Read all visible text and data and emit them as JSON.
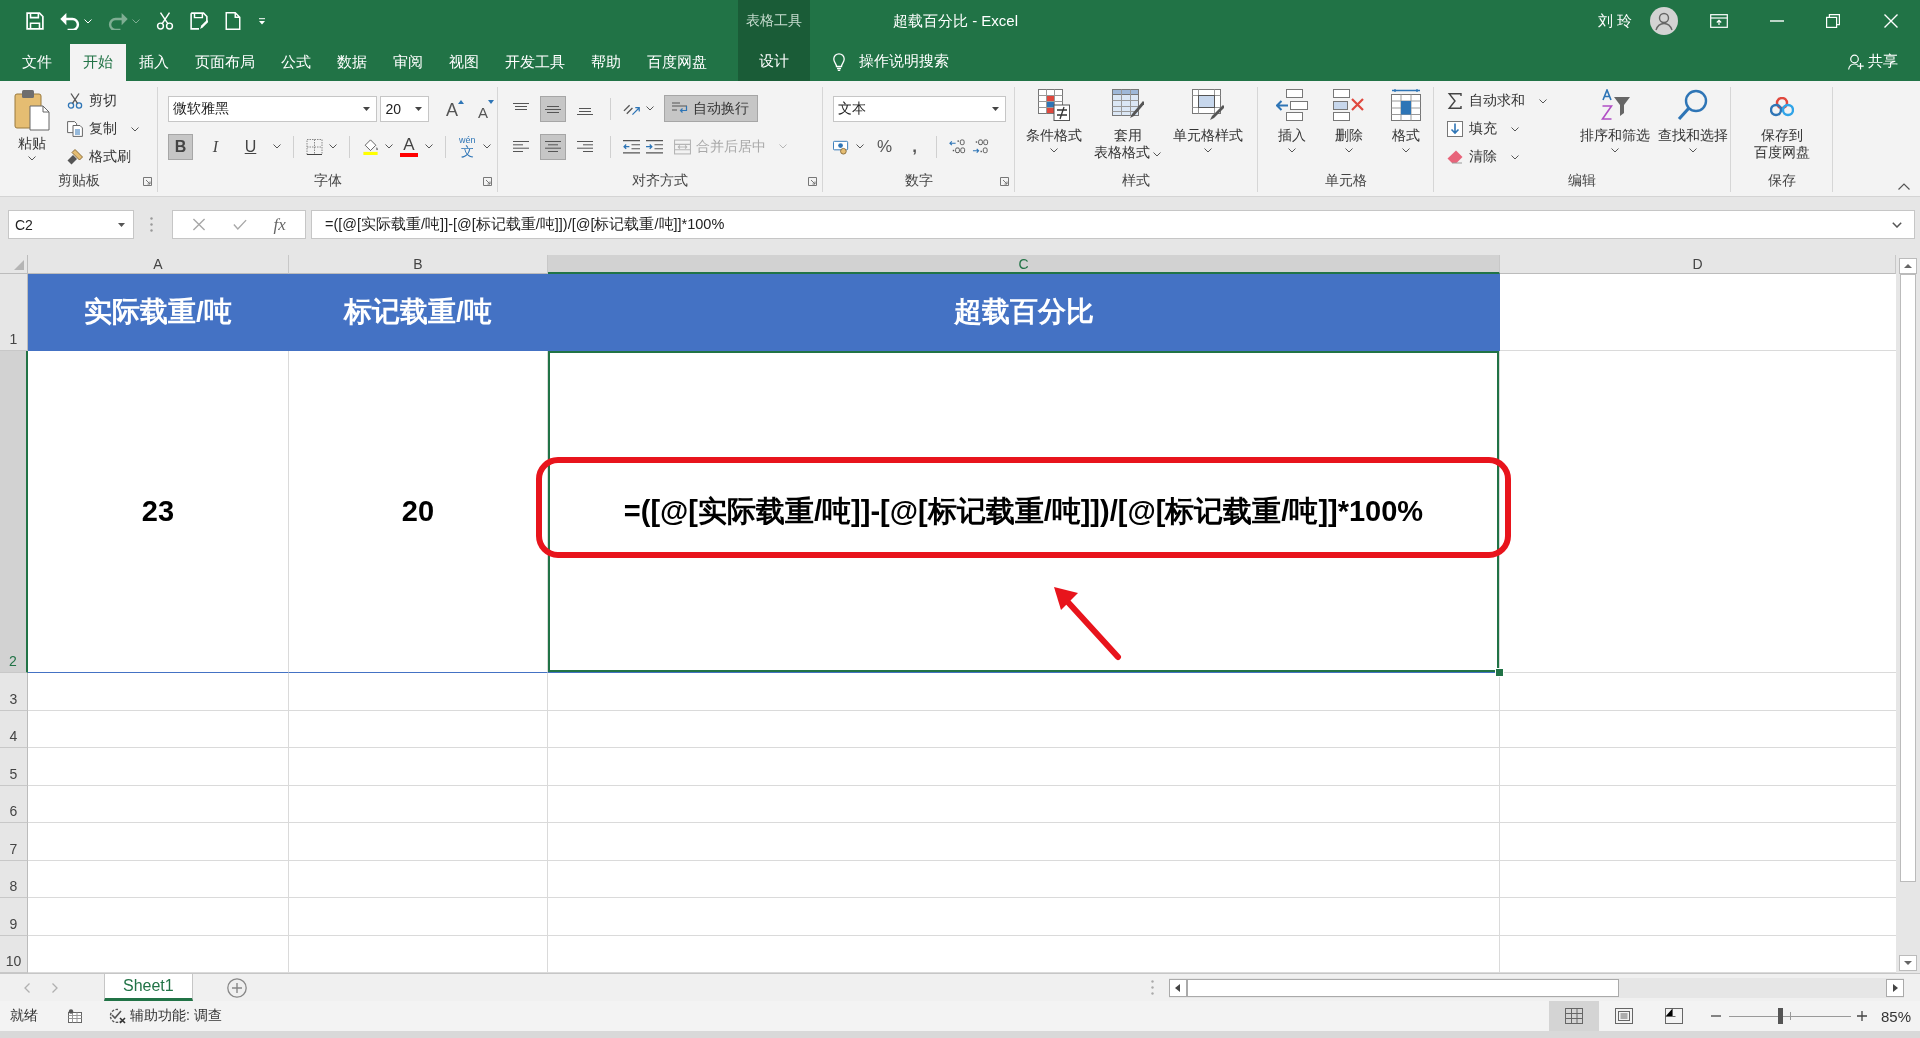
{
  "title_bar": {
    "context_label": "表格工具",
    "title": "超载百分比 - Excel",
    "user_name": "刘 玲"
  },
  "ribbon_tabs": [
    {
      "label": "文件",
      "kind": "normal",
      "selected": false
    },
    {
      "label": "开始",
      "kind": "normal",
      "selected": true
    },
    {
      "label": "插入",
      "kind": "normal",
      "selected": false
    },
    {
      "label": "页面布局",
      "kind": "normal",
      "selected": false
    },
    {
      "label": "公式",
      "kind": "normal",
      "selected": false
    },
    {
      "label": "数据",
      "kind": "normal",
      "selected": false
    },
    {
      "label": "审阅",
      "kind": "normal",
      "selected": false
    },
    {
      "label": "视图",
      "kind": "normal",
      "selected": false
    },
    {
      "label": "开发工具",
      "kind": "normal",
      "selected": false
    },
    {
      "label": "帮助",
      "kind": "normal",
      "selected": false
    },
    {
      "label": "百度网盘",
      "kind": "normal",
      "selected": false
    },
    {
      "label": "设计",
      "kind": "contextual",
      "selected": false
    }
  ],
  "tell_me": {
    "label": "操作说明搜索"
  },
  "share_button": {
    "label": "共享"
  },
  "ribbon": {
    "clipboard": {
      "label": "剪贴板",
      "paste": "粘贴",
      "actions": [
        {
          "kind": "cut",
          "label": "剪切"
        },
        {
          "kind": "copy",
          "label": "复制"
        },
        {
          "kind": "format_painter",
          "label": "格式刷"
        }
      ]
    },
    "font": {
      "label": "字体",
      "font_name": "微软雅黑",
      "font_size": "20",
      "grow_font": "A",
      "shrink_font": "A",
      "styles": [
        {
          "kind": "bold",
          "label": "B",
          "on": true
        },
        {
          "kind": "italic",
          "label": "I",
          "on": false
        },
        {
          "kind": "underline",
          "label": "U",
          "on": false
        }
      ],
      "font_color": "A",
      "phonetic": {
        "pinyin": "wén",
        "character": "文"
      }
    },
    "alignment": {
      "label": "对齐方式",
      "vertical": [
        {
          "kind": "top",
          "selected": false
        },
        {
          "kind": "middle",
          "selected": true
        },
        {
          "kind": "bottom",
          "selected": false
        }
      ],
      "horizontal": [
        {
          "kind": "left",
          "selected": false
        },
        {
          "kind": "center",
          "selected": true
        },
        {
          "kind": "right",
          "selected": false
        }
      ],
      "wrap_text": {
        "label": "自动换行",
        "on": true
      },
      "merge_center": {
        "label": "合并后居中",
        "disabled": true
      }
    },
    "number": {
      "label": "数字",
      "format": "文本",
      "symbols": [
        {
          "kind": "percent",
          "label": "%"
        },
        {
          "kind": "comma",
          "label": ","
        }
      ]
    },
    "styles": {
      "label": "样式",
      "buttons": [
        {
          "kind": "conditional_formatting",
          "lines": [
            "条件格式"
          ]
        },
        {
          "kind": "format_as_table",
          "lines": [
            "套用",
            "表格格式"
          ]
        },
        {
          "kind": "cell_styles",
          "lines": [
            "单元格样式"
          ]
        }
      ]
    },
    "cells": {
      "label": "单元格",
      "buttons": [
        {
          "kind": "insert",
          "label": "插入"
        },
        {
          "kind": "delete",
          "label": "删除"
        },
        {
          "kind": "format",
          "label": "格式"
        }
      ]
    },
    "editing": {
      "label": "编辑",
      "actions": [
        {
          "kind": "autosum",
          "label": "自动求和"
        },
        {
          "kind": "fill",
          "label": "填充"
        },
        {
          "kind": "clear",
          "label": "清除"
        }
      ],
      "buttons": [
        {
          "kind": "sort_filter",
          "label": "排序和筛选"
        },
        {
          "kind": "find_select",
          "label": "查找和选择"
        }
      ]
    },
    "save": {
      "label": "保存",
      "button": {
        "lines": [
          "保存到",
          "百度网盘"
        ]
      }
    }
  },
  "formula_bar": {
    "name_box": "C2",
    "function_label": "fx",
    "formula": "=([@[实际载重/吨]]-[@[标记载重/吨]])/[@[标记载重/吨]]*100%"
  },
  "sheet": {
    "columns": [
      {
        "label": "A",
        "selected": false
      },
      {
        "label": "B",
        "selected": false
      },
      {
        "label": "C",
        "selected": true
      },
      {
        "label": "D",
        "selected": false
      }
    ],
    "rows": [
      {
        "label": "1",
        "selected": false,
        "cells": [
          {
            "kind": "header",
            "text": "实际载重/吨",
            "selected": false
          },
          {
            "kind": "header",
            "text": "标记载重/吨",
            "selected": false
          },
          {
            "kind": "header",
            "text": "超载百分比",
            "selected": false
          }
        ]
      },
      {
        "label": "2",
        "selected": true,
        "cells": [
          {
            "kind": "value",
            "text": "23",
            "selected": false
          },
          {
            "kind": "value",
            "text": "20",
            "selected": false
          },
          {
            "kind": "value",
            "text": "=([@[实际载重/吨]]-[@[标记载重/吨]])/[@[标记载重/吨]]*100%",
            "selected": true
          }
        ]
      },
      {
        "label": "3",
        "selected": false
      },
      {
        "label": "4",
        "selected": false
      },
      {
        "label": "5",
        "selected": false
      },
      {
        "label": "6",
        "selected": false
      },
      {
        "label": "7",
        "selected": false
      },
      {
        "label": "8",
        "selected": false
      },
      {
        "label": "9",
        "selected": false
      },
      {
        "label": "10",
        "selected": false
      }
    ]
  },
  "sheet_tabs": [
    {
      "label": "Sheet1",
      "selected": true
    }
  ],
  "status_bar": {
    "status": "就绪",
    "accessibility": "辅助功能: 调查",
    "views": [
      {
        "kind": "normal",
        "selected": true
      },
      {
        "kind": "page_layout",
        "selected": false
      },
      {
        "kind": "page_break_preview",
        "selected": false
      }
    ],
    "zoom": {
      "level": 0.42,
      "reading": "85%"
    }
  }
}
